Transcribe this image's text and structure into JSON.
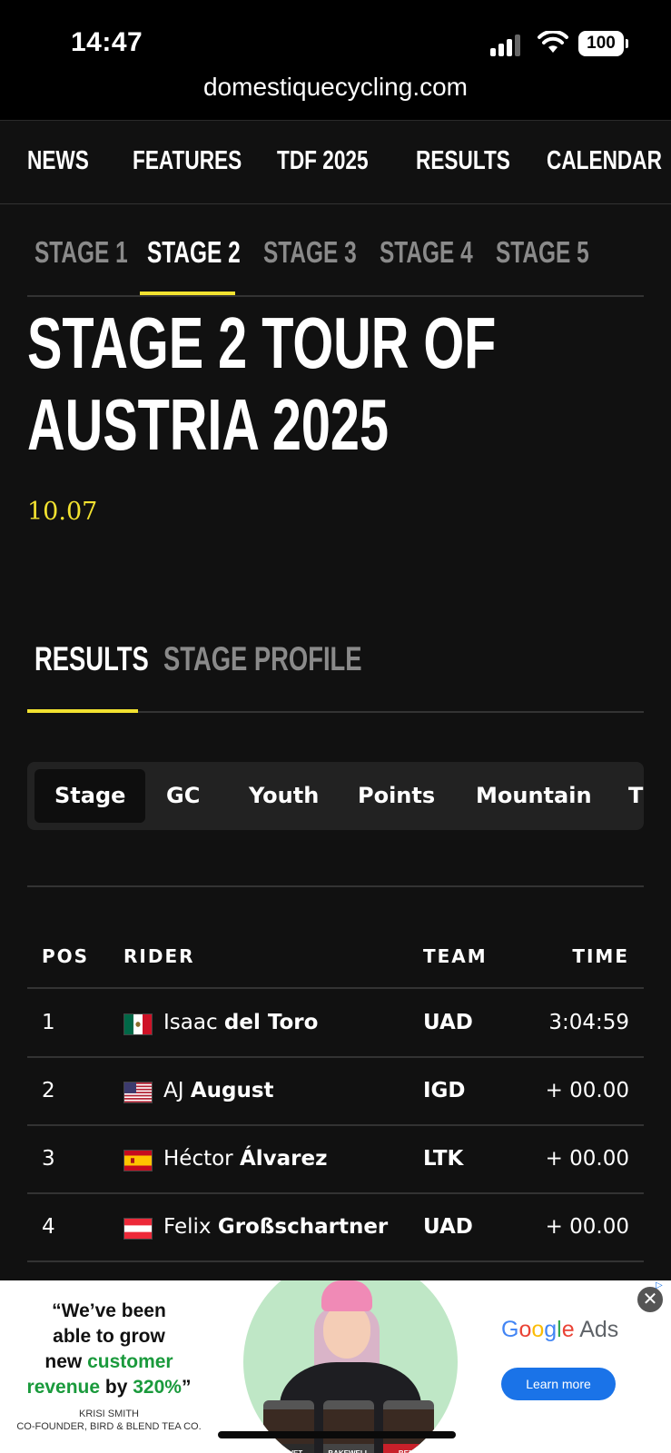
{
  "status_bar": {
    "time": "14:47",
    "battery": "100",
    "url": "domestiquecycling.com"
  },
  "main_nav": [
    "NEWS",
    "FEATURES",
    "TDF 2025",
    "RESULTS",
    "CALENDAR"
  ],
  "stage_tabs": {
    "items": [
      "STAGE 1",
      "STAGE 2",
      "STAGE 3",
      "STAGE 4",
      "STAGE 5"
    ],
    "active": "STAGE 2"
  },
  "article": {
    "title_line1": "STAGE 2 TOUR OF",
    "title_line2": "AUSTRIA 2025",
    "date": "10.07"
  },
  "result_tabs": {
    "items": [
      "RESULTS",
      "STAGE PROFILE"
    ],
    "active": "RESULTS"
  },
  "classification_pills": {
    "items": [
      "Stage",
      "GC",
      "Youth",
      "Points",
      "Mountain",
      "T"
    ],
    "active": "Stage"
  },
  "results_table": {
    "headers": {
      "pos": "POS",
      "rider": "RIDER",
      "team": "TEAM",
      "time": "TIME"
    },
    "rows": [
      {
        "pos": "1",
        "first": "Isaac",
        "last": "del Toro",
        "flag": "mexico-flag",
        "team": "UAD",
        "time": "3:04:59"
      },
      {
        "pos": "2",
        "first": "AJ",
        "last": "August",
        "flag": "usa-flag",
        "team": "IGD",
        "time": "+ 00.00"
      },
      {
        "pos": "3",
        "first": "Héctor",
        "last": "Álvarez",
        "flag": "spain-flag",
        "team": "LTK",
        "time": "+ 00.00"
      },
      {
        "pos": "4",
        "first": "Felix",
        "last": "Großschartner",
        "flag": "austria-flag",
        "team": "UAD",
        "time": "+ 00.00"
      }
    ]
  },
  "ad": {
    "quote_l1": "“We’ve been",
    "quote_l2": "able to grow",
    "quote_l3": "new ",
    "quote_l3_green": "customer",
    "quote_l4_green1": "revenue",
    "quote_l4_mid": " by ",
    "quote_l4_green2": "320%",
    "quote_l4_end": "”",
    "name": "KRISI SMITH",
    "role": "CO-FOUNDER, BIRD & BLEND TEA CO.",
    "jar_labels": [
      "VELVET",
      "BAKEWELL",
      "BEER"
    ],
    "brand_g": [
      "G",
      "o",
      "o",
      "g",
      "l",
      "e"
    ],
    "brand_ads": " Ads",
    "cta": "Learn more",
    "close": "✕"
  }
}
